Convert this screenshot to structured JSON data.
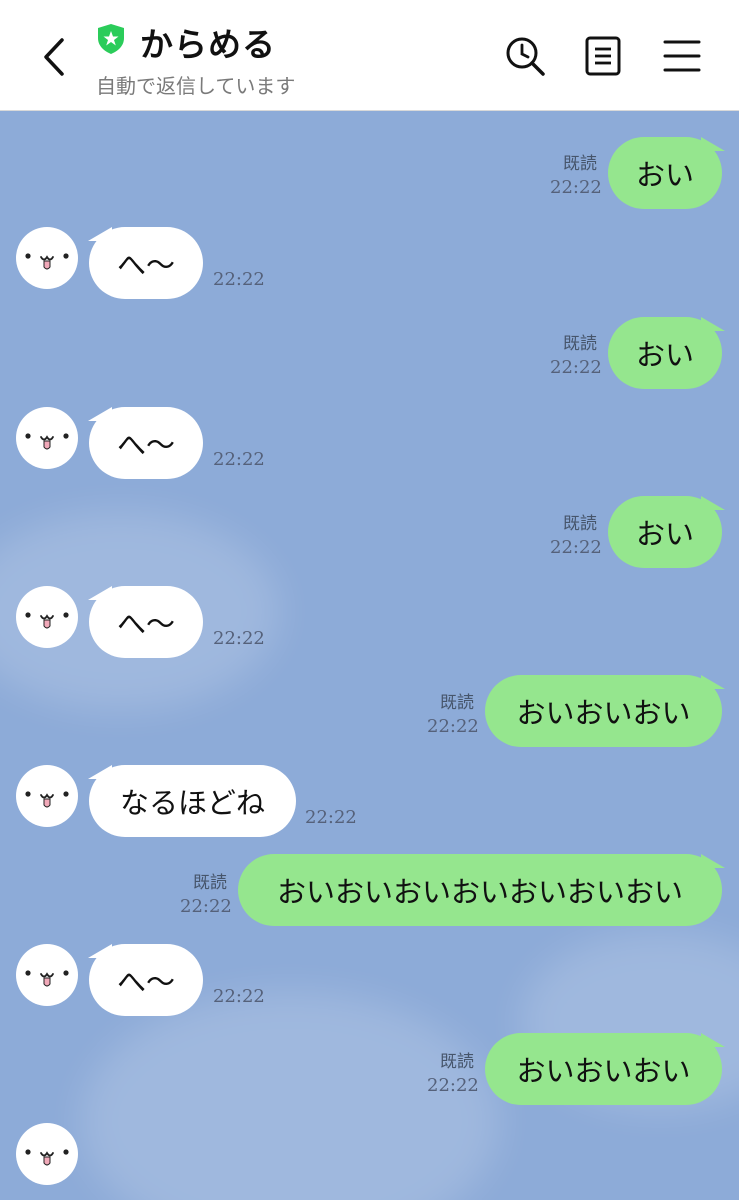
{
  "header": {
    "title": "からめる",
    "subtitle": "自動で返信しています",
    "icons": [
      "back-icon",
      "verified-shield-icon",
      "search-history-icon",
      "notes-icon",
      "menu-icon"
    ]
  },
  "colors": {
    "chat_background": "#8dabd8",
    "outgoing_bubble": "#95e68e",
    "incoming_bubble": "#ffffff",
    "shield": "#2bcc5a"
  },
  "messages": [
    {
      "dir": "out",
      "text": "おい",
      "read": "既読",
      "time": "22:22"
    },
    {
      "dir": "in",
      "text": "へ〜",
      "time": "22:22"
    },
    {
      "dir": "out",
      "text": "おい",
      "read": "既読",
      "time": "22:22"
    },
    {
      "dir": "in",
      "text": "へ〜",
      "time": "22:22"
    },
    {
      "dir": "out",
      "text": "おい",
      "read": "既読",
      "time": "22:22"
    },
    {
      "dir": "in",
      "text": "へ〜",
      "time": "22:22"
    },
    {
      "dir": "out",
      "text": "おいおいおい",
      "read": "既読",
      "time": "22:22"
    },
    {
      "dir": "in",
      "text": "なるほどね",
      "time": "22:22"
    },
    {
      "dir": "out",
      "text": "おいおいおいおいおいおいおい",
      "read": "既読",
      "time": "22:22"
    },
    {
      "dir": "in",
      "text": "へ〜",
      "time": "22:22"
    },
    {
      "dir": "out",
      "text": "おいおいおい",
      "read": "既読",
      "time": "22:22"
    }
  ]
}
